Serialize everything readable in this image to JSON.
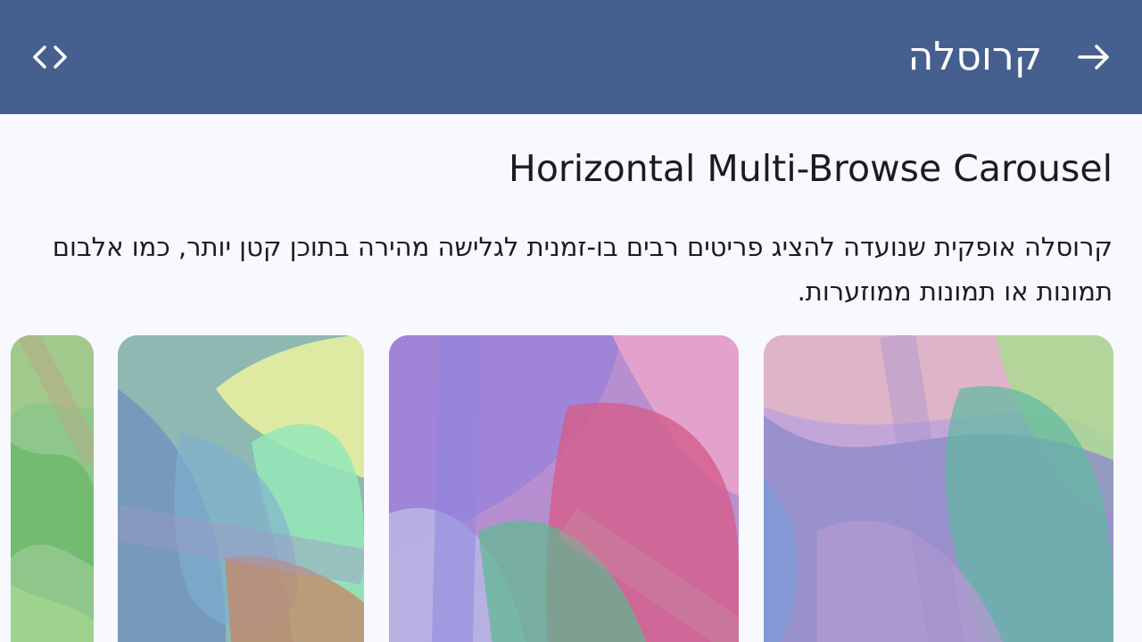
{
  "app_bar": {
    "title": "קרוסלה",
    "back_icon": "arrow-back-icon",
    "code_icon": "code-icon",
    "color": "#455f8f"
  },
  "heading": "Horizontal Multi-Browse Carousel",
  "description": "קרוסלה אופקית שנועדה להציג פריטים רבים בו-זמנית לגלישה מהירה בתוכן קטן יותר, כמו אלבום תמונות או תמונות ממוזערות.",
  "carousel": {
    "items": [
      {
        "name": "image-1",
        "palette": [
          "#a7c8ef",
          "#c9a2e6",
          "#8ed7b7",
          "#7ea6dc"
        ]
      },
      {
        "name": "image-2",
        "palette": [
          "#e5a7d6",
          "#9b87d9",
          "#d86090",
          "#79c7a5"
        ]
      },
      {
        "name": "image-3",
        "palette": [
          "#9fd5b7",
          "#f0f2a2",
          "#7fa3d7",
          "#c58e70"
        ]
      },
      {
        "name": "image-4",
        "palette": [
          "#91c98c",
          "#7dc06e",
          "#b7c97b",
          "#9bd18f"
        ]
      }
    ]
  }
}
